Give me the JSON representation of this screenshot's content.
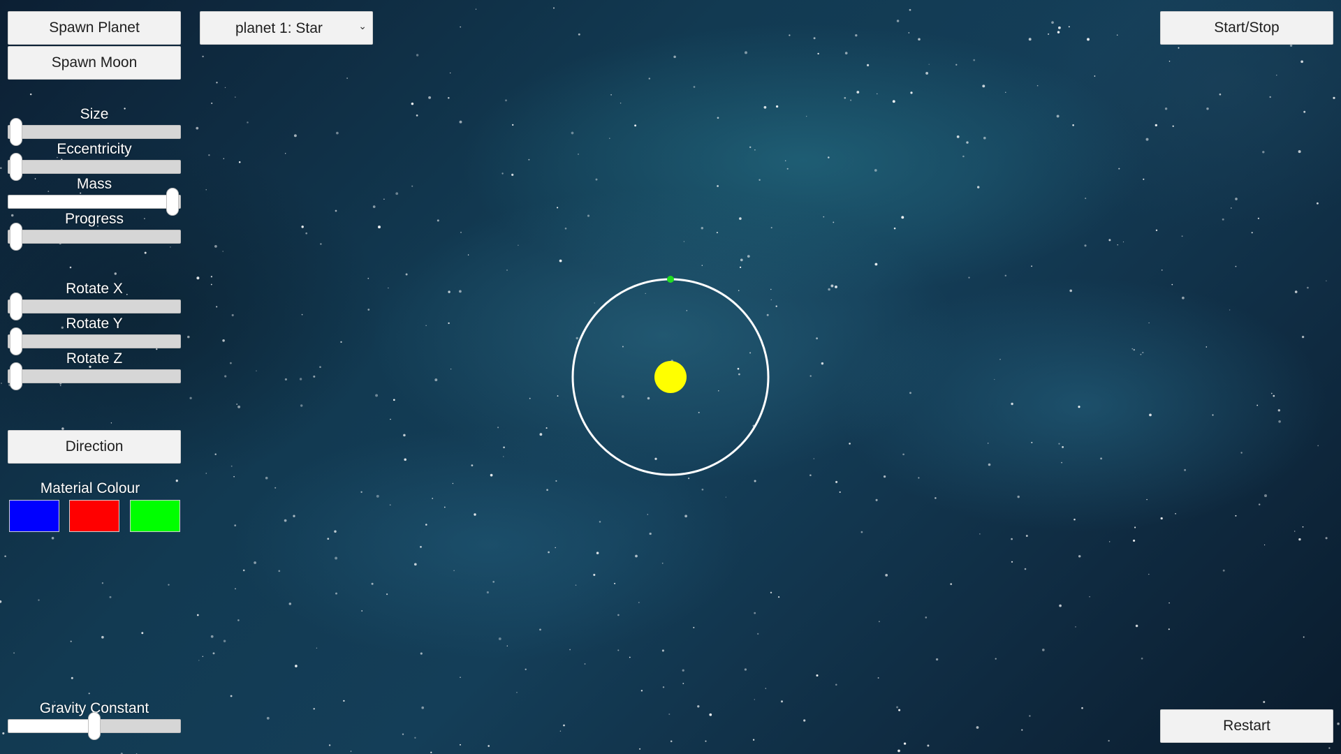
{
  "toolbar": {
    "spawn_planet_label": "Spawn Planet",
    "spawn_moon_label": "Spawn Moon",
    "start_stop_label": "Start/Stop",
    "restart_label": "Restart",
    "direction_label": "Direction"
  },
  "planet_select": {
    "selected": "planet 1: Star",
    "arrow_icon": "chevron-down-icon"
  },
  "sliders": {
    "size": {
      "label": "Size",
      "value": 0.0
    },
    "eccentricity": {
      "label": "Eccentricity",
      "value": 0.0
    },
    "mass": {
      "label": "Mass",
      "value": 1.0
    },
    "progress": {
      "label": "Progress",
      "value": 0.0
    },
    "rotate_x": {
      "label": "Rotate X",
      "value": 0.0
    },
    "rotate_y": {
      "label": "Rotate Y",
      "value": 0.0
    },
    "rotate_z": {
      "label": "Rotate Z",
      "value": 0.0
    },
    "gravity": {
      "label": "Gravity Constant",
      "value": 0.5
    }
  },
  "material": {
    "label": "Material Colour",
    "colors": [
      "#0000ff",
      "#ff0000",
      "#00ff00"
    ]
  },
  "scene": {
    "star_color": "#ffff00",
    "orbit_color": "#ffffff",
    "planet_color": "#22dd22"
  }
}
